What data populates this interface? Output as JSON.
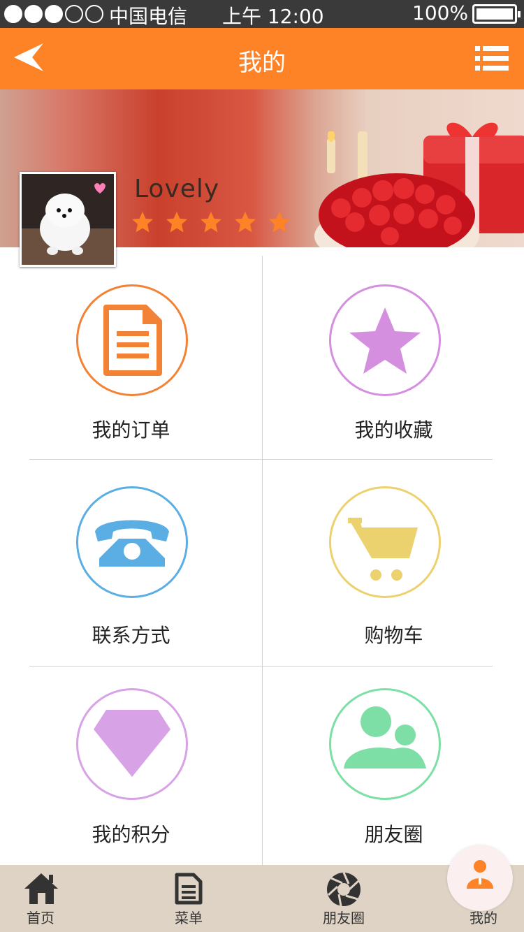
{
  "status_bar": {
    "signal_bars": 5,
    "signal_filled": 3,
    "carrier": "中国电信",
    "time": "上午 12:00",
    "battery": "100%"
  },
  "header": {
    "title": "我的",
    "back_icon": "back-arrow-icon",
    "menu_icon": "list-menu-icon",
    "background_color": "#fe8326"
  },
  "profile": {
    "username": "Lovely",
    "rating": 5,
    "rating_max": 5,
    "star_color": "#fe8326"
  },
  "menu_items": [
    {
      "label": "我的订单",
      "icon": "document-icon",
      "color": "#f28235"
    },
    {
      "label": "我的收藏",
      "icon": "star-icon",
      "color": "#d48fdf"
    },
    {
      "label": "联系方式",
      "icon": "telephone-icon",
      "color": "#5aaee3"
    },
    {
      "label": "购物车",
      "icon": "shopping-cart-icon",
      "color": "#ecd16f"
    },
    {
      "label": "我的积分",
      "icon": "diamond-icon",
      "color": "#d8a2e6"
    },
    {
      "label": "朋友圈",
      "icon": "friends-icon",
      "color": "#7ddfa6"
    }
  ],
  "tab_bar": {
    "items": [
      {
        "label": "首页",
        "icon": "home-icon"
      },
      {
        "label": "菜单",
        "icon": "menu-document-icon"
      },
      {
        "label": "朋友圈",
        "icon": "aperture-icon"
      },
      {
        "label": "我的",
        "icon": "person-icon"
      }
    ],
    "active_index": 3,
    "active_color": "#fe8326"
  }
}
